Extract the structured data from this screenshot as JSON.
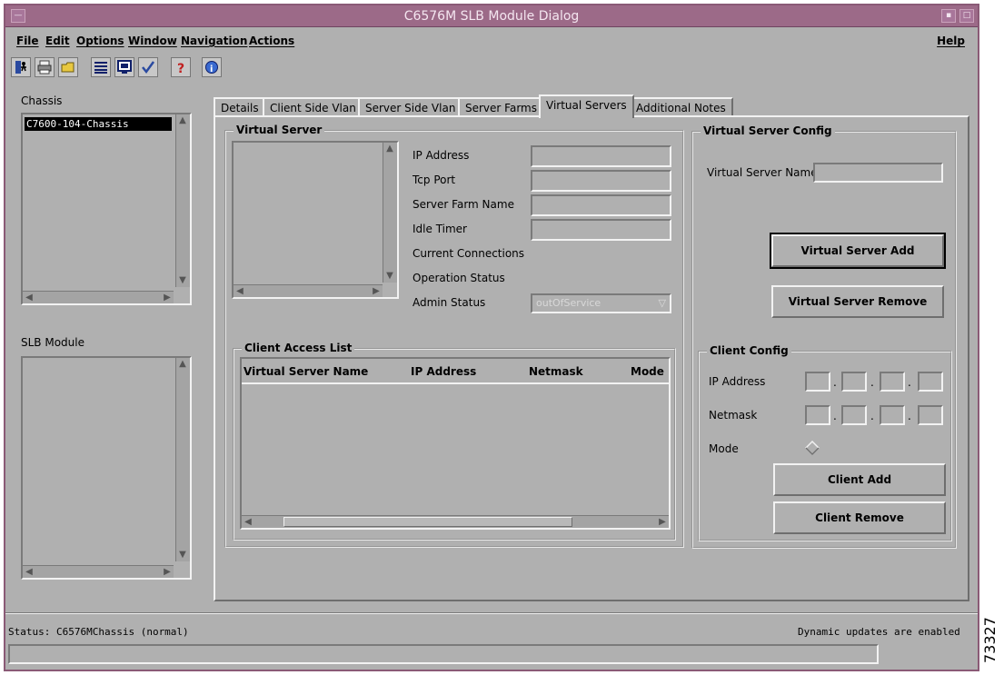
{
  "window": {
    "title": "C6576M SLB Module Dialog",
    "title_color": "#9c6a88",
    "background": "#b0b0b0"
  },
  "menubar": {
    "file": "File",
    "edit": "Edit",
    "options": "Options",
    "window": "Window",
    "navigation": "Navigation",
    "actions": "Actions",
    "help": "Help"
  },
  "toolbar": {
    "icons": [
      "exit-icon",
      "print-icon",
      "open-folder-icon",
      "list-icon",
      "monitor-icon",
      "checkmark-icon",
      "help-question-icon",
      "info-icon"
    ]
  },
  "left": {
    "chassis_label": "Chassis",
    "chassis_items": [
      "C7600-104-Chassis"
    ],
    "slb_label": "SLB Module"
  },
  "tabs": [
    "Details",
    "Client Side Vlan",
    "Server Side Vlan",
    "Server Farms",
    "Virtual Servers",
    "Additional Notes"
  ],
  "active_tab": "Virtual Servers",
  "virtual_server": {
    "title": "Virtual Server",
    "ip_address_label": "IP Address",
    "tcp_port_label": "Tcp Port",
    "server_farm_label": "Server Farm Name",
    "idle_timer_label": "Idle Timer",
    "current_connections_label": "Current Connections",
    "operation_status_label": "Operation Status",
    "admin_status_label": "Admin Status",
    "admin_status_value": "outOfService"
  },
  "client_access_list": {
    "title": "Client Access List",
    "columns": [
      "Virtual Server Name",
      "IP Address",
      "Netmask",
      "Mode"
    ]
  },
  "vs_config": {
    "title": "Virtual Server Config",
    "name_label": "Virtual Server Name",
    "add_button": "Virtual Server Add",
    "remove_button": "Virtual Server Remove"
  },
  "client_config": {
    "title": "Client Config",
    "ip_label": "IP Address",
    "netmask_label": "Netmask",
    "mode_label": "Mode",
    "add_button": "Client Add",
    "remove_button": "Client Remove"
  },
  "status": {
    "left": "Status: C6576MChassis (normal)",
    "right": "Dynamic updates are enabled"
  },
  "figure_number": "73327"
}
